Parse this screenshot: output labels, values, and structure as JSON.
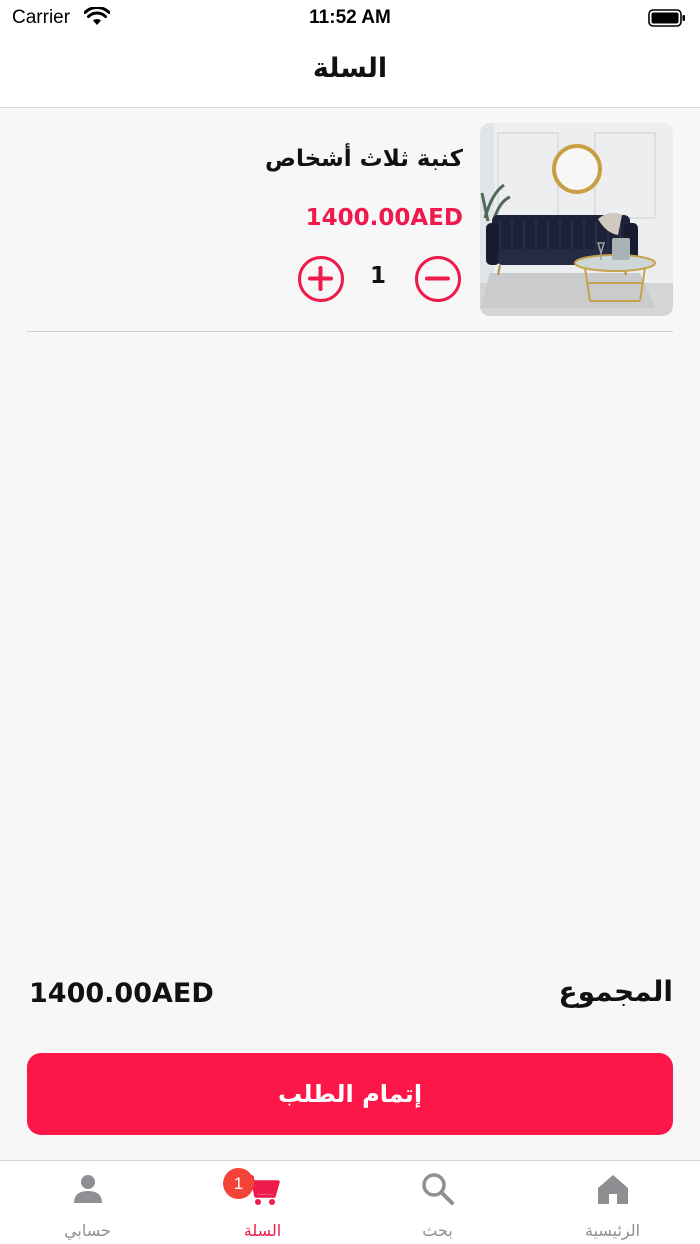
{
  "status_bar": {
    "carrier": "Carrier",
    "time": "11:52 AM"
  },
  "header": {
    "title": "السلة"
  },
  "cart": {
    "items": [
      {
        "name": "كنبة ثلاث أشخاص",
        "price": "1400.00AED",
        "quantity": "1",
        "image": "three-seater-sofa-photo"
      }
    ]
  },
  "summary": {
    "total_label": "المجموع",
    "total_value": "1400.00AED"
  },
  "checkout": {
    "label": "إتمام الطلب"
  },
  "tab_bar": {
    "tabs": [
      {
        "label": "حسابي",
        "icon": "person-icon"
      },
      {
        "label": "السلة",
        "icon": "cart-icon",
        "badge": "1",
        "active": true
      },
      {
        "label": "بحث",
        "icon": "search-icon"
      },
      {
        "label": "الرئيسية",
        "icon": "home-icon"
      }
    ]
  },
  "colors": {
    "accent": "#ed1a4b",
    "checkout": "#fd1748",
    "badge": "#f4443a",
    "inactive_tab": "#8e8e93"
  }
}
